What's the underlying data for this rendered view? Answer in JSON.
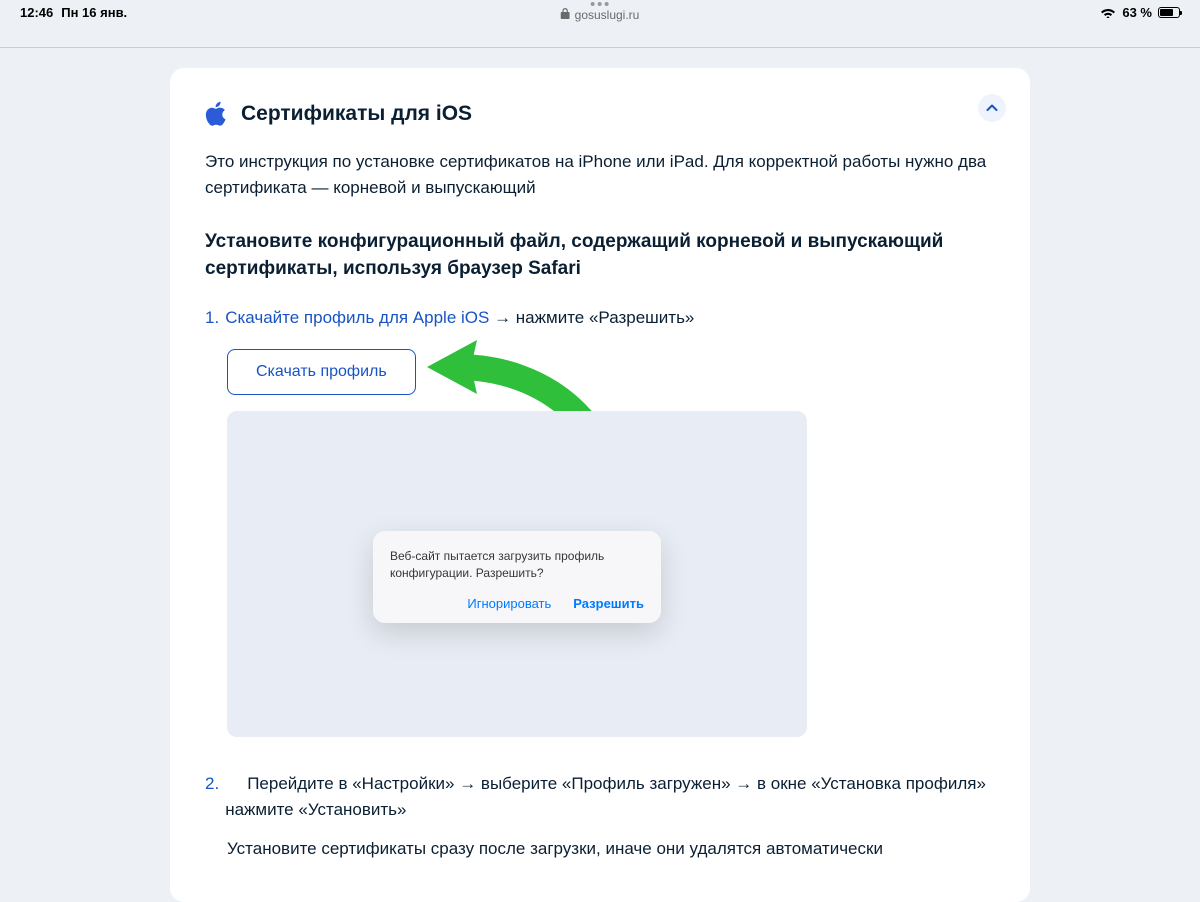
{
  "status": {
    "time": "12:46",
    "date": "Пн 16 янв.",
    "url": "gosuslugi.ru",
    "battery_pct": "63 %"
  },
  "card": {
    "title": "Сертификаты для iOS",
    "intro": "Это инструкция по установке сертификатов на iPhone или iPad. Для корректной работы нужно два сертификата — корневой и выпускающий",
    "subtitle": "Установите конфигурационный файл, содержащий корневой и выпускающий сертификаты, используя браузер Safari",
    "step1": {
      "num": "1.",
      "link": "Скачайте профиль для Apple iOS",
      "rest": " → нажмите «Разрешить»"
    },
    "download_label": "Скачать профиль",
    "dialog": {
      "text": "Веб-сайт пытается загрузить профиль конфигурации. Разрешить?",
      "ignore": "Игнорировать",
      "allow": "Разрешить"
    },
    "step2": {
      "num": "2.",
      "text": "Перейдите в «Настройки» → выберите «Профиль загружен» → в окне «Установка профиля» нажмите «Установить»",
      "note": "Установите сертификаты сразу после загрузки, иначе они удалятся автоматически"
    }
  }
}
